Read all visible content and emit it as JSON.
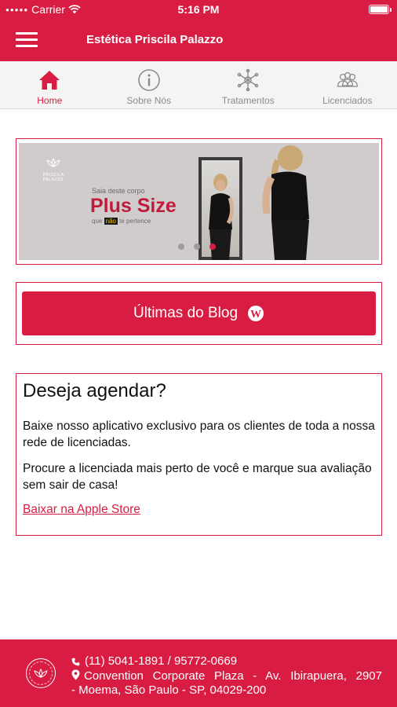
{
  "status_bar": {
    "carrier": "Carrier",
    "time": "5:16 PM"
  },
  "header": {
    "title": "Estética Priscila Palazzo"
  },
  "tabs": [
    {
      "label": "Home",
      "icon": "home-icon",
      "active": true
    },
    {
      "label": "Sobre Nós",
      "icon": "info-icon",
      "active": false
    },
    {
      "label": "Tratamentos",
      "icon": "treatments-icon",
      "active": false
    },
    {
      "label": "Licenciados",
      "icon": "people-icon",
      "active": false
    }
  ],
  "banner": {
    "brand_text": "PRISCILA PALAZZO",
    "line1": "Saia deste corpo",
    "headline": "Plus Size",
    "line3_pre": "que ",
    "line3_hl": "não",
    "line3_post": " te pertence",
    "slides": 3,
    "active_slide": 3
  },
  "blog": {
    "button_label": "Últimas do Blog",
    "icon": "wordpress-icon"
  },
  "schedule": {
    "title": "Deseja agendar?",
    "paragraph1": "Baixe nosso aplicativo exclusivo para os clientes de toda a nossa rede de licenciadas.",
    "paragraph2": "Procure a licenciada mais perto de você e marque sua avaliação sem sair de casa!",
    "link": "Baixar na Apple Store"
  },
  "footer": {
    "phones": "(11) 5041-1891 / 95772-0669",
    "address_line1": "Convention Corporate Plaza - Av. Ibirapuera, 2907",
    "address_line2": "- Moema, São Paulo - SP, 04029-200"
  },
  "colors": {
    "brand": "#d91c42",
    "tab_inactive": "#8c8c8c",
    "tab_bar_bg": "#f4f4f4"
  }
}
